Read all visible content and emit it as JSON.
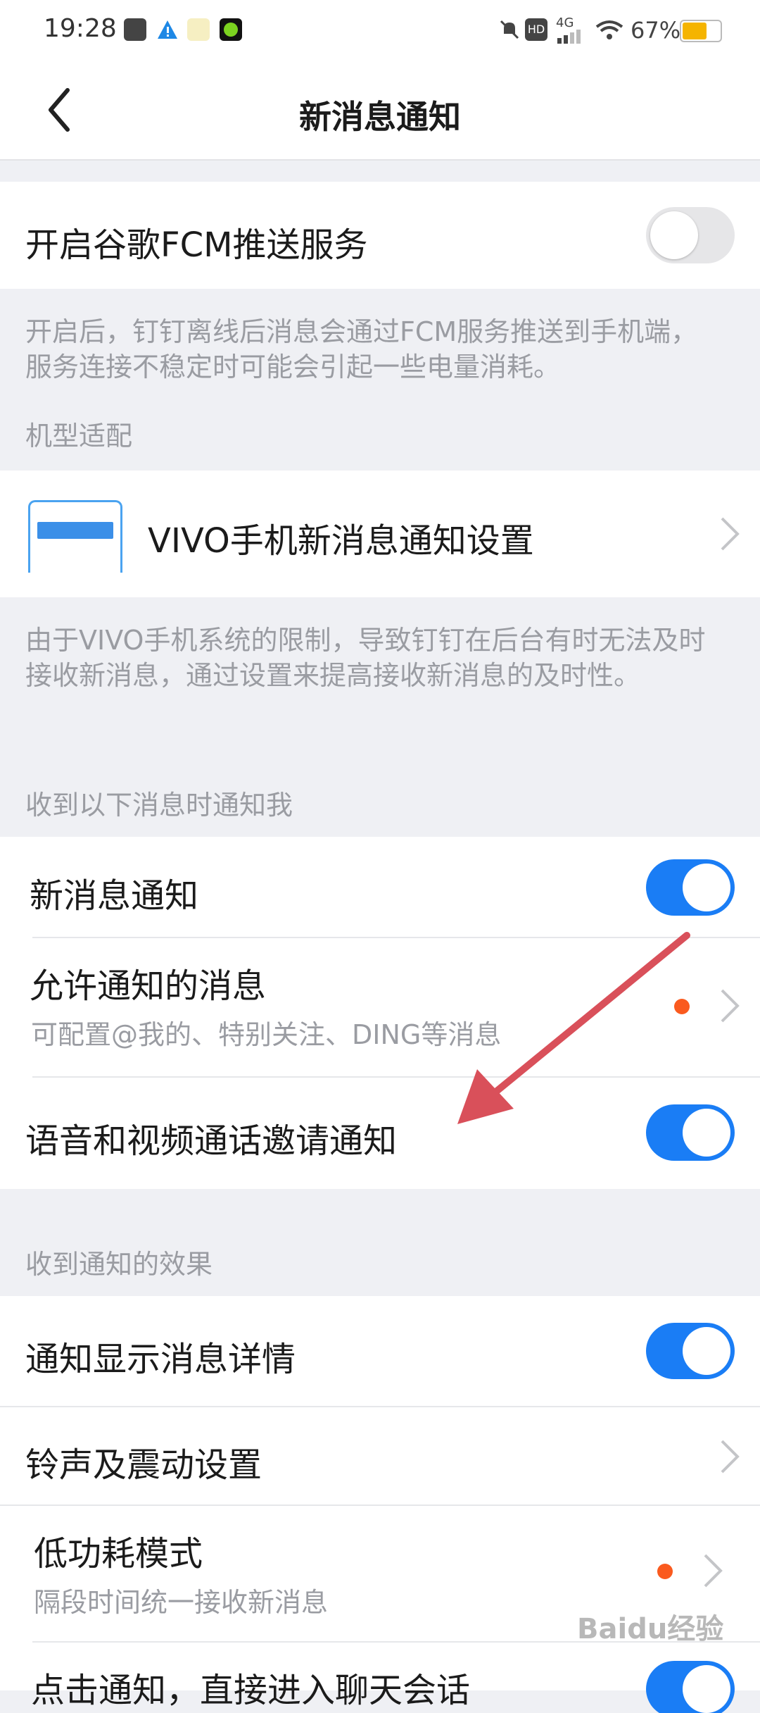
{
  "status_bar": {
    "time": "19:28",
    "battery_percent": "67%",
    "network": "4G"
  },
  "header": {
    "title": "新消息通知"
  },
  "fcm": {
    "label": "开启谷歌FCM推送服务",
    "enabled": false,
    "description": "开启后，钉钉离线后消息会通过FCM服务推送到手机端，服务连接不稳定时可能会引起一些电量消耗。"
  },
  "device_adapt": {
    "section_label": "机型适配",
    "item_label": "VIVO手机新消息通知设置",
    "description": "由于VIVO手机系统的限制，导致钉钉在后台有时无法及时接收新消息，通过设置来提高接收新消息的及时性。"
  },
  "notify_section": {
    "label": "收到以下消息时通知我",
    "items": [
      {
        "label": "新消息通知",
        "enabled": true
      },
      {
        "label": "允许通知的消息",
        "sub": "可配置@我的、特别关注、DING等消息"
      },
      {
        "label": "语音和视频通话邀请通知",
        "enabled": true
      }
    ]
  },
  "effect_section": {
    "label": "收到通知的效果",
    "items": [
      {
        "label": "通知显示消息详情",
        "enabled": true
      },
      {
        "label": "铃声及震动设置"
      },
      {
        "label": "低功耗模式",
        "sub": "隔段时间统一接收新消息"
      },
      {
        "label": "点击通知，直接进入聊天会话",
        "enabled": true
      }
    ]
  },
  "colors": {
    "accent": "#1a7df5",
    "annotation_arrow": "#d9505a",
    "badge_dot": "#fa5a1e"
  },
  "watermark": "Baidu经验"
}
